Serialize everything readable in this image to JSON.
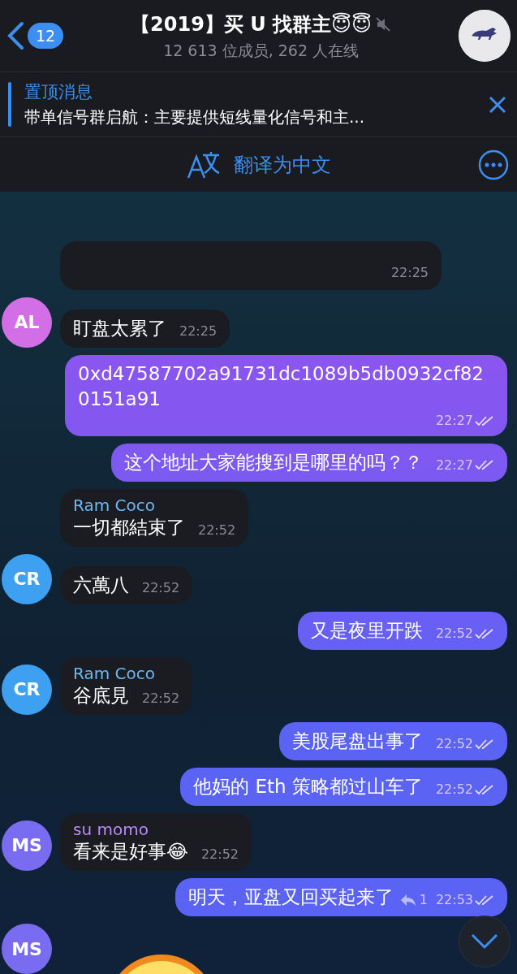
{
  "header": {
    "back_count": "12",
    "title": "【2019】买 U 找群主😇😇",
    "muted": true,
    "subtitle": "12 613 位成员, 262 人在线"
  },
  "pinned": {
    "label": "置顶消息",
    "text": "带单信号群启航：主要提供短线量化信号和主..."
  },
  "translate": {
    "label": "翻译为中文"
  },
  "messages": [
    {
      "kind": "in",
      "time": "22:25"
    },
    {
      "kind": "in",
      "avatar": {
        "initials": "AL",
        "color": "#d36fe6"
      },
      "text": "盯盘太累了",
      "time": "22:25"
    },
    {
      "kind": "out",
      "text": "0xd47587702a91731dc1089b5db0932cf820151a91",
      "time": "22:27",
      "read": true
    },
    {
      "kind": "out",
      "text": "这个地址大家能搜到是哪里的吗？？",
      "time": "22:27",
      "read": true
    },
    {
      "kind": "in",
      "sender": {
        "name": "Ram Coco",
        "color": "#6cb8f5"
      },
      "text": "一切都結束了",
      "time": "22:52"
    },
    {
      "kind": "in",
      "avatar": {
        "initials": "CR",
        "color": "#3ea0f0"
      },
      "text": "六萬八",
      "time": "22:52"
    },
    {
      "kind": "out",
      "text": "又是夜里开跌",
      "time": "22:52",
      "read": true
    },
    {
      "kind": "in",
      "sender": {
        "name": "Ram Coco",
        "color": "#6cb8f5"
      },
      "avatar": {
        "initials": "CR",
        "color": "#3ea0f0"
      },
      "text": "谷底見",
      "time": "22:52"
    },
    {
      "kind": "out",
      "text": "美股尾盘出事了",
      "time": "22:52",
      "read": true
    },
    {
      "kind": "out",
      "text": "他妈的 Eth 策略都过山车了",
      "time": "22:52",
      "read": true
    },
    {
      "kind": "in",
      "sender": {
        "name": "su momo",
        "color": "#b48cf2"
      },
      "avatar": {
        "initials": "MS",
        "color": "#7a6cf0"
      },
      "text": "看来是好事😂",
      "time": "22:52"
    },
    {
      "kind": "out",
      "text": "明天，亚盘又回买起来了",
      "replies": "1",
      "time": "22:53",
      "read": true
    },
    {
      "kind": "sticker",
      "avatar": {
        "initials": "MS",
        "color": "#7a6cf0"
      }
    }
  ]
}
